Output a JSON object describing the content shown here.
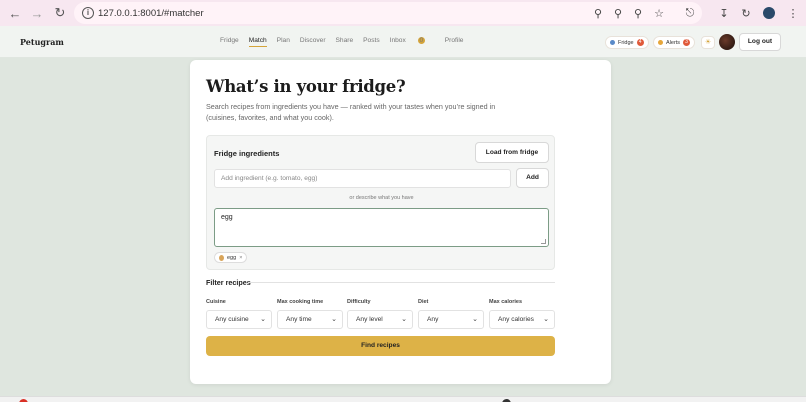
{
  "browser": {
    "url": "127.0.0.1:8001/#matcher"
  },
  "app": {
    "logo": "Petugram",
    "nav": [
      {
        "label": "Fridge"
      },
      {
        "label": "Match"
      },
      {
        "label": "Plan"
      },
      {
        "label": "Discover"
      },
      {
        "label": "Share"
      },
      {
        "label": "Posts"
      },
      {
        "label": "Inbox"
      },
      {
        "label": "Profile"
      }
    ],
    "active_nav": "Match",
    "inbox_count": "0",
    "fridge_pill": {
      "label": "Fridge",
      "count": "4"
    },
    "alerts_pill": {
      "label": "Alerts",
      "count": "3"
    },
    "logout_label": "Log out"
  },
  "page": {
    "title": "What’s in your fridge?",
    "subtitle": "Search recipes from ingredients you have — ranked with your tastes when you’re signed in (cuisines, favorites, and what you cook).",
    "fridge": {
      "heading": "Fridge ingredients",
      "load_label": "Load from fridge",
      "input_placeholder": "Add ingredient (e.g. tomato, egg)",
      "add_label": "Add",
      "or_describe": "or describe what you have",
      "description_value": "egg",
      "chips": [
        "egg"
      ]
    },
    "filters": {
      "heading": "Filter recipes",
      "items": [
        {
          "label": "Cuisine",
          "value": "Any cuisine"
        },
        {
          "label": "Max cooking time",
          "value": "Any time"
        },
        {
          "label": "Difficulty",
          "value": "Any level"
        },
        {
          "label": "Diet",
          "value": "Any"
        },
        {
          "label": "Max calories",
          "value": "Any calories"
        }
      ]
    },
    "find_label": "Find recipes"
  },
  "colors": {
    "accent": "#ddb247",
    "background": "#dfe6df",
    "badge": "#e05a3a"
  }
}
